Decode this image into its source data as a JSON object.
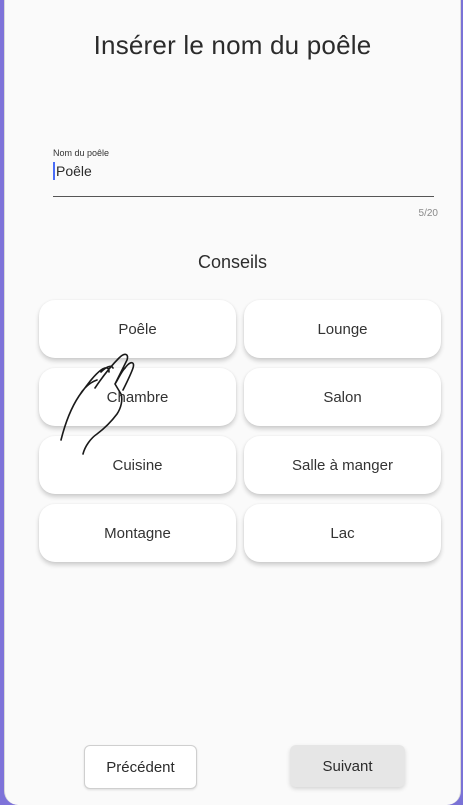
{
  "screen": {
    "title": "Insérer le nom du poêle"
  },
  "name_field": {
    "label": "Nom du poêle",
    "value": "Poêle",
    "counter": "5/20"
  },
  "tips": {
    "title": "Conseils",
    "items": [
      {
        "label": "Poêle"
      },
      {
        "label": "Lounge"
      },
      {
        "label": "Chambre"
      },
      {
        "label": "Salon"
      },
      {
        "label": "Cuisine"
      },
      {
        "label": "Salle à manger"
      },
      {
        "label": "Montagne"
      },
      {
        "label": "Lac"
      }
    ]
  },
  "footer": {
    "prev_label": "Précédent",
    "next_label": "Suivant"
  },
  "overlay": {
    "icon": "hand-tap-icon"
  },
  "colors": {
    "accent": "#7e73d9",
    "cursor": "#4a6cf7"
  }
}
